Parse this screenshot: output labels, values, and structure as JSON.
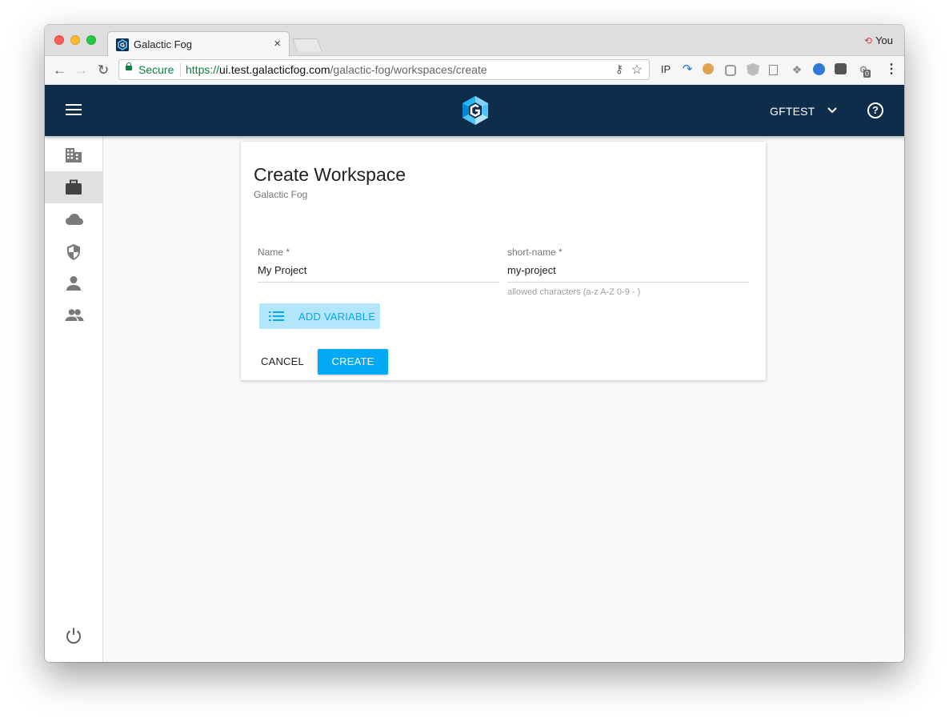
{
  "browser": {
    "tab_title": "Galactic Fog",
    "tab_close": "×",
    "profile_name": "You",
    "url_scheme": "https://",
    "url_host": "ui.test.galacticfog.com",
    "url_path": "/galactic-fog/workspaces/create",
    "secure_label": "Secure",
    "extensions": [
      "IP",
      "share-icon",
      "cookie-icon",
      "ring-icon",
      "angular-icon",
      "copy-icon",
      "dropbox-icon",
      "globe-icon",
      "box-icon",
      "badge-icon"
    ],
    "extension_badge_count": "0"
  },
  "header": {
    "org_name": "GFTEST",
    "help": "?"
  },
  "sidebar": {
    "items": [
      {
        "name": "organizations",
        "icon": "building-icon",
        "active": false
      },
      {
        "name": "workspaces",
        "icon": "briefcase-icon",
        "active": true
      },
      {
        "name": "providers",
        "icon": "cloud-icon",
        "active": false
      },
      {
        "name": "security",
        "icon": "shield-icon",
        "active": false
      },
      {
        "name": "user",
        "icon": "person-icon",
        "active": false
      },
      {
        "name": "groups",
        "icon": "group-icon",
        "active": false
      }
    ],
    "bottom_icon": "power-icon"
  },
  "form": {
    "title": "Create Workspace",
    "subtitle": "Galactic Fog",
    "name_label": "Name *",
    "name_value": "My Project",
    "shortname_label": "short-name *",
    "shortname_value": "my-project",
    "shortname_help": "allowed characters (a-z A-Z 0-9 - )",
    "add_variable_label": "ADD VARIABLE",
    "cancel_label": "CANCEL",
    "create_label": "CREATE"
  },
  "colors": {
    "appbar": "#0e2d4a",
    "primary": "#03a9f4",
    "primary_light": "#b3e5fc",
    "secure_green": "#0b8043"
  }
}
